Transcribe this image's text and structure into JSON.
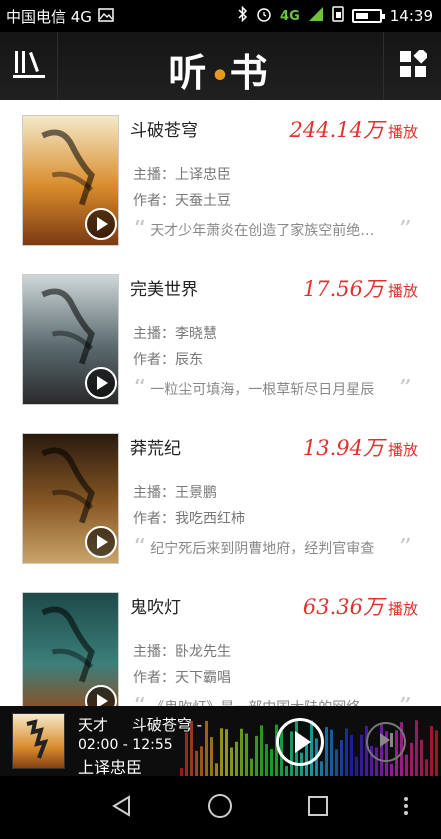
{
  "status_bar": {
    "carrier": "中国电信 4G",
    "time": "14:39",
    "icons": [
      "image-icon",
      "bluetooth-icon",
      "alarm-icon",
      "4g-signal-icon",
      "sim-icon",
      "battery-icon"
    ],
    "net_label": "4G"
  },
  "app_bar": {
    "title_left": "听",
    "title_dot": "•",
    "title_right": "书",
    "left_icon": "library-icon",
    "right_icon": "grid-icon"
  },
  "books": [
    {
      "title": "斗破苍穹",
      "play_count": "244.14万",
      "play_unit": "播放",
      "host": "主播：上译忠臣",
      "author": "作者：天蚕土豆",
      "desc": "天才少年萧炎在创造了家族空前绝后的修炼纪录后突然成了废人",
      "cover_colors": [
        "#f4e9c9",
        "#d98b2b",
        "#7a3a14"
      ]
    },
    {
      "title": "完美世界",
      "play_count": "17.56万",
      "play_unit": "播放",
      "host": "主播：李晓慧",
      "author": "作者：辰东",
      "desc": "一粒尘可填海，一根草斩尽日月星辰",
      "cover_colors": [
        "#cfd7d8",
        "#5b6b70",
        "#2a2a2a"
      ]
    },
    {
      "title": "莽荒纪",
      "play_count": "13.94万",
      "play_unit": "播放",
      "host": "主播：王景鹏",
      "author": "作者：我吃西红柿",
      "desc": "纪宁死后来到阴曹地府，经判官审查",
      "cover_colors": [
        "#2a1a0e",
        "#8a5a26",
        "#c9a46a"
      ]
    },
    {
      "title": "鬼吹灯",
      "play_count": "63.36万",
      "play_unit": "播放",
      "host": "主播：卧龙先生",
      "author": "作者：天下霸唱",
      "desc": "《鬼吹灯》是一部中国大陆的网络小说",
      "cover_colors": [
        "#1d4a4a",
        "#3c7f7a",
        "#a04410"
      ]
    }
  ],
  "player": {
    "marquee": "天才     斗破苍穹 -",
    "time": "02:00 - 12:55",
    "narrator": "上译忠臣"
  },
  "nav": {
    "back_icon": "back-triangle-icon",
    "home_icon": "home-circle-icon",
    "recent_icon": "recent-square-icon",
    "menu_icon": "menu-dots-icon"
  }
}
